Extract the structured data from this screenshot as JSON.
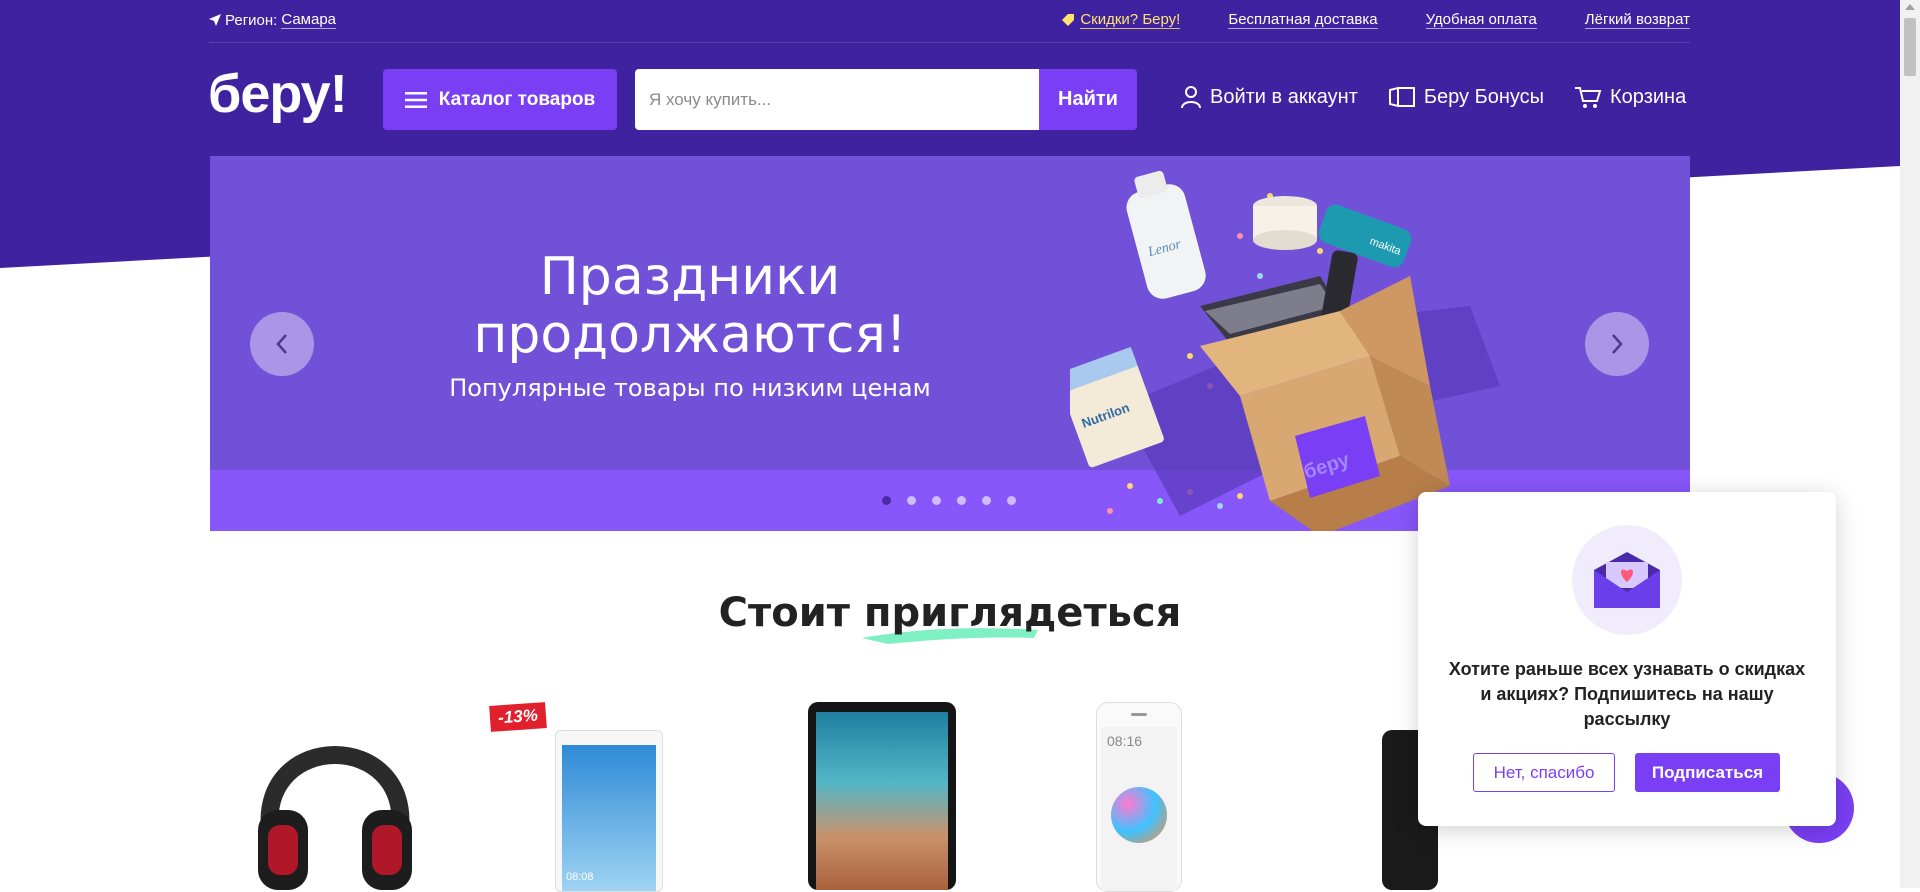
{
  "topbar": {
    "region_label": "Регион:",
    "region_value": "Самара",
    "promo": "Скидки? Беру!",
    "delivery": "Бесплатная доставка",
    "payment": "Удобная оплата",
    "return": "Лёгкий возврат"
  },
  "header": {
    "logo": "беру!",
    "catalog_label": "Каталог товаров",
    "search_placeholder": "Я хочу купить...",
    "search_button": "Найти",
    "login": "Войти в аккаунт",
    "bonuses": "Беру Бонусы",
    "cart": "Корзина"
  },
  "banner": {
    "title_line1": "Праздники",
    "title_line2": "продолжаются!",
    "subtitle": "Популярные товары по низким ценам",
    "box_brand": "беру",
    "product_labels": [
      "Lenor",
      "Nutrilon",
      "makita"
    ],
    "slides_total": 6,
    "active_slide": 1
  },
  "section": {
    "title": "Стоит приглядеться",
    "discount_badge": "-13%",
    "phone_time_1": "08:08",
    "phone_time_2": "08:16"
  },
  "popup": {
    "message": "Хотите раньше всех узнавать о скидках и акциях? Подпишитесь на нашу рассылку",
    "no_button": "Нет, спасибо",
    "yes_button": "Подписаться"
  },
  "colors": {
    "brand_purple": "#3f22a0",
    "accent_purple": "#7a3ff5",
    "banner_bg": "#7151d7",
    "promo_yellow": "#ffe36b",
    "highlight_green": "#7ef0c4"
  }
}
